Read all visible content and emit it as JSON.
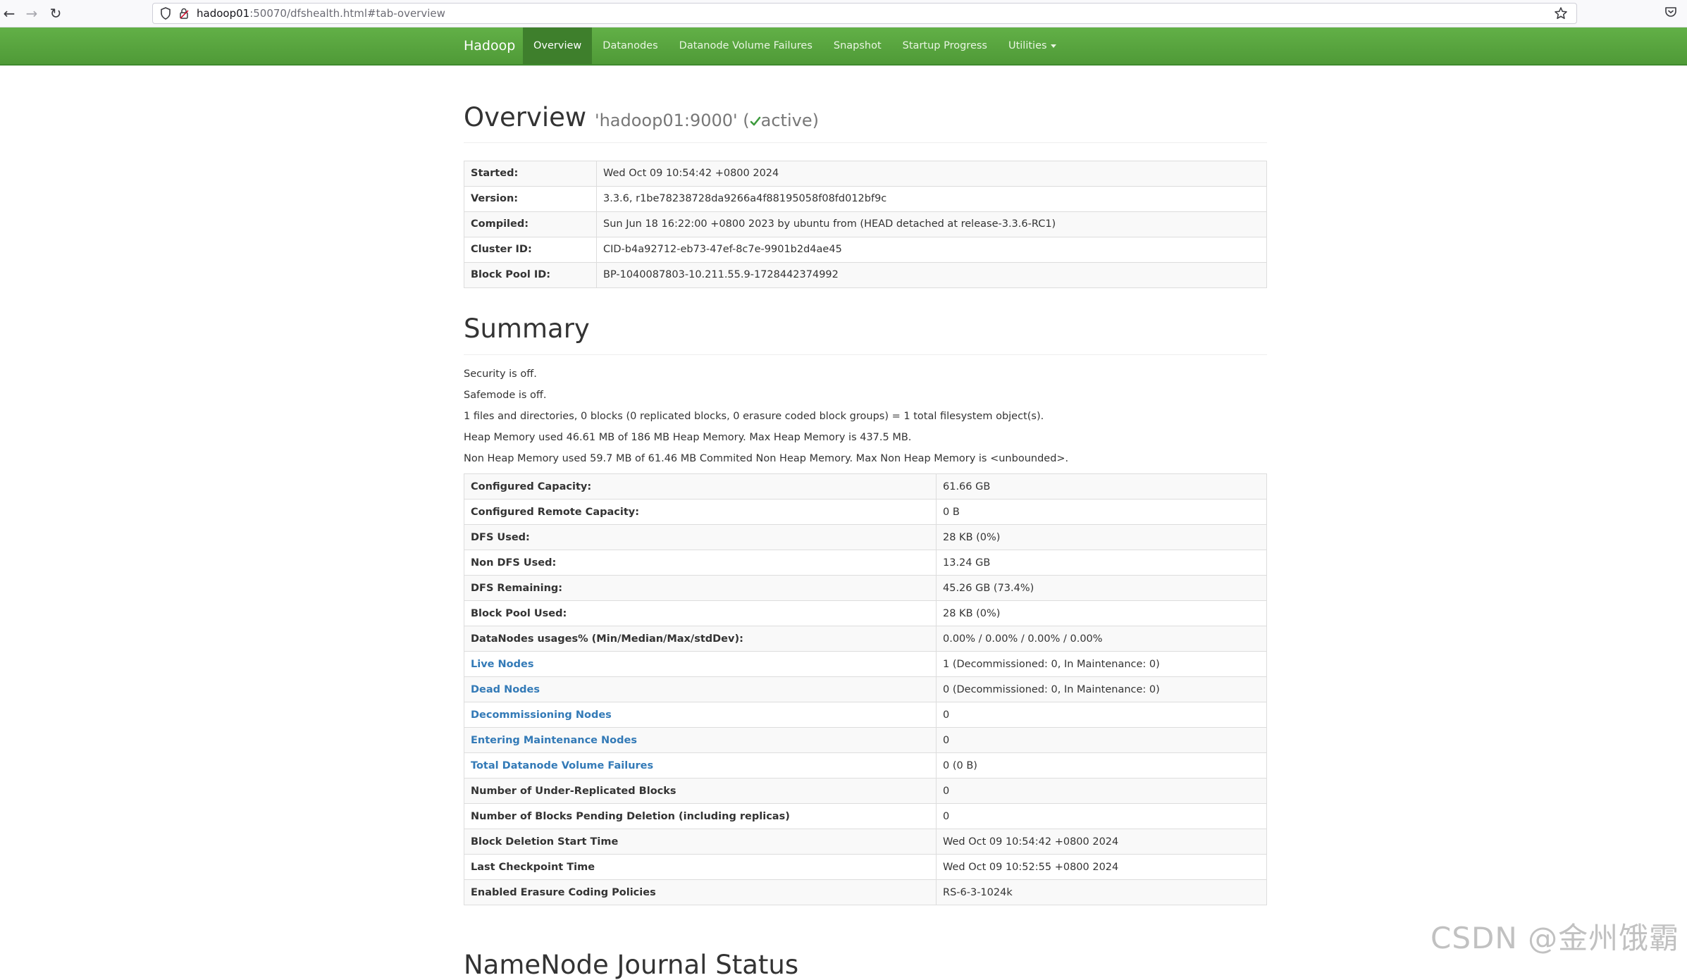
{
  "browser": {
    "url_host": "hadoop01",
    "url_rest": ":50070/dfshealth.html#tab-overview",
    "icons": [
      "back-arrow-icon",
      "forward-arrow-icon",
      "reload-icon",
      "shield-icon",
      "lock-icon",
      "star-icon",
      "pocket-icon"
    ]
  },
  "navbar": {
    "brand": "Hadoop",
    "items": [
      {
        "label": "Overview",
        "active": true
      },
      {
        "label": "Datanodes"
      },
      {
        "label": "Datanode Volume Failures"
      },
      {
        "label": "Snapshot"
      },
      {
        "label": "Startup Progress"
      },
      {
        "label": "Utilities"
      }
    ],
    "color": "#5aa540"
  },
  "overview": {
    "title": "Overview",
    "host": "'hadoop01:9000'",
    "paren_open": "(",
    "status": "active",
    "paren_close": ")",
    "rows": [
      {
        "label": "Started:",
        "value": "Wed Oct 09 10:54:42 +0800 2024"
      },
      {
        "label": "Version:",
        "value": "3.3.6, r1be78238728da9266a4f88195058f08fd012bf9c"
      },
      {
        "label": "Compiled:",
        "value": "Sun Jun 18 16:22:00 +0800 2023 by ubuntu from (HEAD detached at release-3.3.6-RC1)"
      },
      {
        "label": "Cluster ID:",
        "value": "CID-b4a92712-eb73-47ef-8c7e-9901b2d4ae45"
      },
      {
        "label": "Block Pool ID:",
        "value": "BP-1040087803-10.211.55.9-1728442374992"
      }
    ]
  },
  "summary": {
    "title": "Summary",
    "lines": [
      "Security is off.",
      "Safemode is off.",
      "1 files and directories, 0 blocks (0 replicated blocks, 0 erasure coded block groups) = 1 total filesystem object(s).",
      "Heap Memory used 46.61 MB of 186 MB Heap Memory. Max Heap Memory is 437.5 MB.",
      "Non Heap Memory used 59.7 MB of 61.46 MB Commited Non Heap Memory. Max Non Heap Memory is <unbounded>."
    ],
    "rows": [
      {
        "label": "Configured Capacity:",
        "value": "61.66 GB",
        "link": false
      },
      {
        "label": "Configured Remote Capacity:",
        "value": "0 B",
        "link": false
      },
      {
        "label": "DFS Used:",
        "value": "28 KB (0%)",
        "link": false
      },
      {
        "label": "Non DFS Used:",
        "value": "13.24 GB",
        "link": false
      },
      {
        "label": "DFS Remaining:",
        "value": "45.26 GB (73.4%)",
        "link": false
      },
      {
        "label": "Block Pool Used:",
        "value": "28 KB (0%)",
        "link": false
      },
      {
        "label": "DataNodes usages% (Min/Median/Max/stdDev):",
        "value": "0.00% / 0.00% / 0.00% / 0.00%",
        "link": false
      },
      {
        "label": "Live Nodes",
        "value": "1 (Decommissioned: 0, In Maintenance: 0)",
        "link": true
      },
      {
        "label": "Dead Nodes",
        "value": "0 (Decommissioned: 0, In Maintenance: 0)",
        "link": true
      },
      {
        "label": "Decommissioning Nodes",
        "value": "0",
        "link": true
      },
      {
        "label": "Entering Maintenance Nodes",
        "value": "0",
        "link": true
      },
      {
        "label": "Total Datanode Volume Failures",
        "value": "0 (0 B)",
        "link": true
      },
      {
        "label": "Number of Under-Replicated Blocks",
        "value": "0",
        "link": false
      },
      {
        "label": "Number of Blocks Pending Deletion (including replicas)",
        "value": "0",
        "link": false
      },
      {
        "label": "Block Deletion Start Time",
        "value": "Wed Oct 09 10:54:42 +0800 2024",
        "link": false
      },
      {
        "label": "Last Checkpoint Time",
        "value": "Wed Oct 09 10:52:55 +0800 2024",
        "link": false
      },
      {
        "label": "Enabled Erasure Coding Policies",
        "value": "RS-6-3-1024k",
        "link": false
      }
    ]
  },
  "next_section_partial": "NameNode Journal Status",
  "watermark": "CSDN @金州饿霸"
}
